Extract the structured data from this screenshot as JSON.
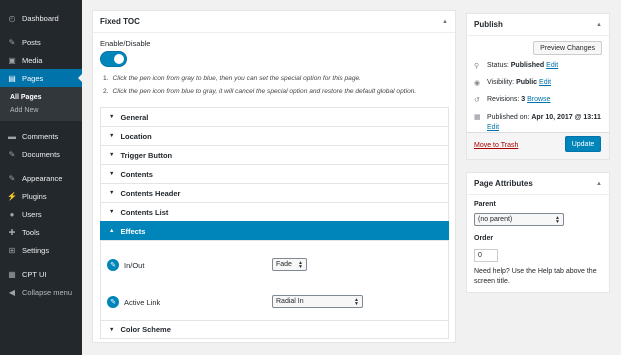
{
  "sidebar": {
    "items": [
      {
        "label": "Dashboard",
        "icon": "dashboard-icon",
        "glyph": "◴"
      },
      {
        "label": "Posts",
        "icon": "pin-icon",
        "glyph": "✎"
      },
      {
        "label": "Media",
        "icon": "media-icon",
        "glyph": "▣"
      },
      {
        "label": "Pages",
        "icon": "pages-icon",
        "glyph": "▤"
      },
      {
        "label": "Comments",
        "icon": "comment-icon",
        "glyph": "▬"
      },
      {
        "label": "Documents",
        "icon": "documents-icon",
        "glyph": "✎"
      },
      {
        "label": "Appearance",
        "icon": "appearance-icon",
        "glyph": "✎"
      },
      {
        "label": "Plugins",
        "icon": "plugins-icon",
        "glyph": "⚡"
      },
      {
        "label": "Users",
        "icon": "users-icon",
        "glyph": "●"
      },
      {
        "label": "Tools",
        "icon": "tools-icon",
        "glyph": "✚"
      },
      {
        "label": "Settings",
        "icon": "settings-icon",
        "glyph": "⊞"
      },
      {
        "label": "CPT UI",
        "icon": "cptui-icon",
        "glyph": "▦"
      },
      {
        "label": "Collapse menu",
        "icon": "collapse-icon",
        "glyph": "◀"
      }
    ],
    "submenu": [
      "All Pages",
      "Add New"
    ]
  },
  "toc": {
    "title": "Fixed TOC",
    "enable_label": "Enable/Disable",
    "tips": [
      "Click the pen icon from gray to blue, then you can set the special option for this page.",
      "Click the pen icon from blue to gray, it will cancel the special option and restore the default global option."
    ],
    "tip_numbers": [
      "1.",
      "2."
    ],
    "sections": [
      "General",
      "Location",
      "Trigger Button",
      "Contents",
      "Contents Header",
      "Contents List",
      "Effects",
      "Color Scheme"
    ],
    "effects": {
      "in_out_label": "In/Out",
      "in_out_value": "Fade",
      "active_link_label": "Active Link",
      "active_link_value": "Radial In"
    }
  },
  "publish": {
    "title": "Publish",
    "preview_label": "Preview Changes",
    "status_label": "Status:",
    "status_value": "Published",
    "visibility_label": "Visibility:",
    "visibility_value": "Public",
    "revisions_label": "Revisions:",
    "revisions_value": "3",
    "browse_label": "Browse",
    "published_label": "Published on:",
    "published_value": "Apr 10, 2017 @ 13:11",
    "edit_label": "Edit",
    "trash_label": "Move to Trash",
    "update_label": "Update"
  },
  "attributes": {
    "title": "Page Attributes",
    "parent_label": "Parent",
    "parent_value": "(no parent)",
    "order_label": "Order",
    "order_value": "0",
    "help_text": "Need help? Use the Help tab above the screen title."
  },
  "colors": {
    "accent": "#0085ba",
    "sidebar": "#23282d",
    "danger": "#aa0000"
  }
}
